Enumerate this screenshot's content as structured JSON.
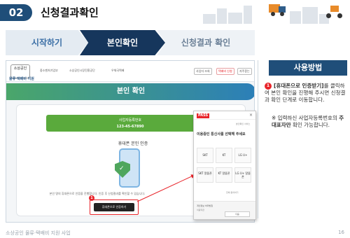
{
  "header": {
    "section_number": "02",
    "section_title": "신청결과확인"
  },
  "steps": [
    {
      "label": "시작하기"
    },
    {
      "label": "본인확인"
    },
    {
      "label": "신청결과 확인"
    }
  ],
  "screenshot": {
    "logo_text": "소상공인",
    "logo_sub": "물류·택배비 지원",
    "partner_logos": [
      "중소벤처기업부",
      "소상공인시장진흥공단",
      "우체국택배"
    ],
    "top_buttons": [
      "사업자 조회",
      "택배비 신청",
      "자주묻는"
    ],
    "banner_title": "본인 확인",
    "biz_label": "사업자등록번호",
    "biz_number": "123-45-67890",
    "phone_auth_title": "휴대폰 본인 인증",
    "phone_auth_desc": "본인 명의 휴대폰으로 인증을 진행합니다. 인증 후 신청결과를 확인할 수 있습니다.",
    "auth_button": "휴대폰으로 인증하기",
    "step_marker": "1"
  },
  "popup": {
    "logo": "PASS",
    "close": "×",
    "notice": "본인확인 서비스",
    "title": "이용중인 통신사를 선택해 주세요",
    "carriers": [
      "SKT",
      "KT",
      "LG U+",
      "SKT 알뜰폰",
      "KT 알뜰폰",
      "LG U+ 알뜰폰"
    ],
    "agree": "전체 동의하기",
    "footer_line1": "개인정보 처리방침",
    "footer_line2": "이용약관",
    "footer_button": "다음"
  },
  "side": {
    "title": "사용방법",
    "marker": "1",
    "p1_bold": "[휴대폰으로 인증받기]",
    "p1_rest": "를 클릭하여 본인 확인을 진행해 주시면 신청결과 확인 단계로 이동합니다.",
    "p2_prefix": "※ 입력하신 사업자등록번호의 ",
    "p2_bold": "주대표자만",
    "p2_rest": " 확인 가능합니다."
  },
  "footer": {
    "left": "소상공인 물류·택배비 지원 사업",
    "page": "16"
  },
  "colors": {
    "navy": "#1f4e79",
    "active_step": "#16365c",
    "accent_red": "#e8242a",
    "green": "#5aaa3c"
  }
}
